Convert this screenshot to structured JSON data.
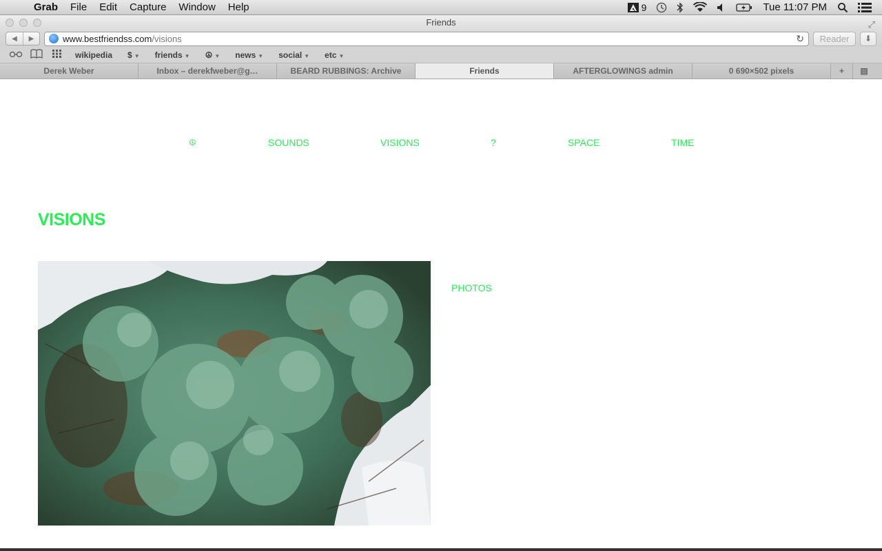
{
  "menubar": {
    "app": "Grab",
    "items": [
      "File",
      "Edit",
      "Capture",
      "Window",
      "Help"
    ],
    "status_badge": "9",
    "clock": "Tue 11:07 PM"
  },
  "window": {
    "title": "Friends"
  },
  "toolbar": {
    "url_domain": "www.bestfriendss.com",
    "url_path": "/visions",
    "reader_label": "Reader"
  },
  "bookmarks": [
    {
      "label": "wikipedia",
      "menu": false
    },
    {
      "label": "$",
      "menu": true
    },
    {
      "label": "friends",
      "menu": true
    },
    {
      "label": "☮",
      "menu": true
    },
    {
      "label": "news",
      "menu": true
    },
    {
      "label": "social",
      "menu": true
    },
    {
      "label": "etc",
      "menu": true
    }
  ],
  "tabs": [
    {
      "label": "Derek Weber",
      "active": false
    },
    {
      "label": "Inbox – derekfweber@g…",
      "active": false
    },
    {
      "label": "BEARD RUBBINGS: Archive",
      "active": false
    },
    {
      "label": "Friends",
      "active": true
    },
    {
      "label": "AFTERGLOWINGS admin",
      "active": false
    },
    {
      "label": "0 690×502 pixels",
      "active": false
    }
  ],
  "site": {
    "nav": [
      "☮",
      "SOUNDS",
      "VISIONS",
      "?",
      "SPACE",
      "TIME"
    ],
    "page_title": "VISIONS",
    "photos_link": "PHOTOS"
  },
  "colors": {
    "accent_green": "#28ee56"
  }
}
